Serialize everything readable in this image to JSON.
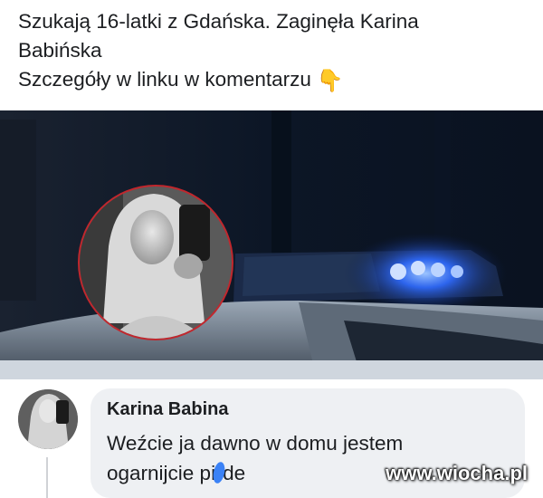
{
  "post": {
    "line1": "Szukają 16-latki z Gdańska. Zaginęła Karina",
    "line2": "Babińska",
    "line3": "Szczegóły w linku w komentarzu",
    "icon": "pointing-down-hand-icon",
    "icon_glyph": "👇"
  },
  "colors": {
    "police_light": "#2f6bff",
    "photo_border": "#c1272d",
    "comment_bubble": "#eef0f3"
  },
  "comment": {
    "author": "Karina Babina",
    "line1": "Weźcie ja dawno w domu jestem",
    "line2_start": "ogarnijcie pi",
    "line2_end": "de"
  },
  "watermark": "www.wiocha.pl"
}
